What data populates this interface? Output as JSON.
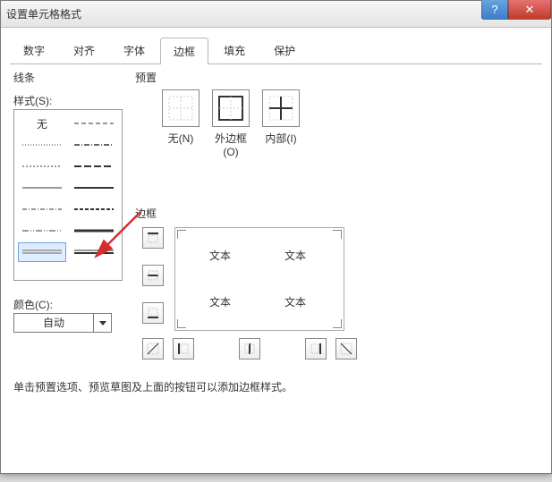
{
  "window": {
    "title": "设置单元格格式"
  },
  "tabs": [
    {
      "label": "数字"
    },
    {
      "label": "对齐"
    },
    {
      "label": "字体"
    },
    {
      "label": "边框",
      "active": true
    },
    {
      "label": "填充"
    },
    {
      "label": "保护"
    }
  ],
  "sections": {
    "lines": "线条",
    "styles_label": "样式(S):",
    "none_style": "无",
    "color_label": "颜色(C):",
    "presets": "预置",
    "border": "边框"
  },
  "color": {
    "value": "自动"
  },
  "preset_buttons": {
    "none": "无(N)",
    "outline": "外边框(O)",
    "inside": "内部(I)"
  },
  "preview": {
    "sample_text": "文本"
  },
  "hint": "单击预置选项、预览草图及上面的按钮可以添加边框样式。"
}
